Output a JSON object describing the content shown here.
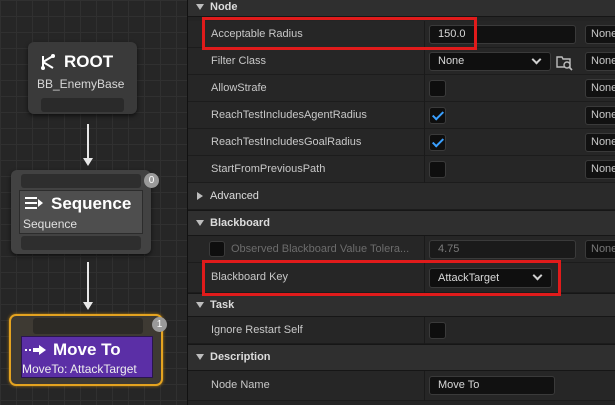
{
  "graph": {
    "root": {
      "title": "ROOT",
      "subtitle": "BB_EnemyBase"
    },
    "sequence": {
      "title": "Sequence",
      "subtitle": "Sequence",
      "badge": "0"
    },
    "move_to": {
      "title": "Move To",
      "subtitle": "MoveTo: AttackTarget",
      "badge": "1"
    },
    "colors": {
      "move_to_body": "#5b2fa6",
      "selection_outline": "#e4a320"
    }
  },
  "details": {
    "categories": {
      "node": "Node",
      "advanced": "Advanced",
      "blackboard": "Blackboard",
      "task": "Task",
      "description": "Description"
    },
    "node": {
      "acceptable_radius": {
        "label": "Acceptable Radius",
        "value": "150.0",
        "side": "None"
      },
      "filter_class": {
        "label": "Filter Class",
        "value": "None",
        "side": "None"
      },
      "allow_strafe": {
        "label": "AllowStrafe",
        "checked": false,
        "side": "None"
      },
      "reach_agent": {
        "label": "ReachTestIncludesAgentRadius",
        "checked": true,
        "side": "None"
      },
      "reach_goal": {
        "label": "ReachTestIncludesGoalRadius",
        "checked": true,
        "side": "None"
      },
      "start_prev": {
        "label": "StartFromPreviousPath",
        "checked": false,
        "side": "None"
      }
    },
    "blackboard": {
      "tolerance": {
        "label": "Observed Blackboard Value Tolera...",
        "value": "4.75",
        "side": "None"
      },
      "key": {
        "label": "Blackboard Key",
        "value": "AttackTarget"
      }
    },
    "task": {
      "ignore_restart": {
        "label": "Ignore Restart Self",
        "checked": false
      }
    },
    "description": {
      "node_name": {
        "label": "Node Name",
        "value": "Move To"
      }
    },
    "highlight_color": "#e01b1b"
  }
}
